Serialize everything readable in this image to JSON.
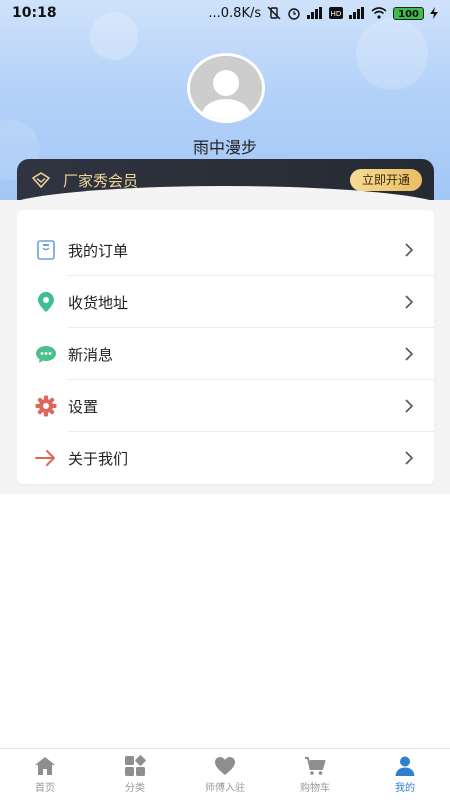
{
  "status_bar": {
    "time": "10:18",
    "speed": "...0.8K/s",
    "battery": "100"
  },
  "profile": {
    "username": "雨中漫步",
    "avatar_icon": "default-avatar-icon"
  },
  "vip": {
    "label": "厂家秀会员",
    "button": "立即开通",
    "icon": "crown-icon"
  },
  "menu": {
    "items": [
      {
        "label": "我的订单",
        "icon": "order-icon",
        "color": "#6fa0d8"
      },
      {
        "label": "收货地址",
        "icon": "location-pin-icon",
        "color": "#3fbf8f"
      },
      {
        "label": "新消息",
        "icon": "message-icon",
        "color": "#4cc08c"
      },
      {
        "label": "设置",
        "icon": "gear-icon",
        "color": "#e0655b"
      },
      {
        "label": "关于我们",
        "icon": "arrow-right-icon",
        "color": "#e0655b"
      }
    ]
  },
  "tabbar": {
    "tabs": [
      {
        "label": "首页",
        "icon": "home-icon"
      },
      {
        "label": "分类",
        "icon": "category-icon"
      },
      {
        "label": "师傅入驻",
        "icon": "heart-icon"
      },
      {
        "label": "购物车",
        "icon": "cart-icon"
      },
      {
        "label": "我的",
        "icon": "user-icon",
        "active": true
      }
    ]
  },
  "colors": {
    "accent": "#2f7fd0",
    "vip_gold": "#f1d59b",
    "header_blue": "#a0c6f6"
  }
}
